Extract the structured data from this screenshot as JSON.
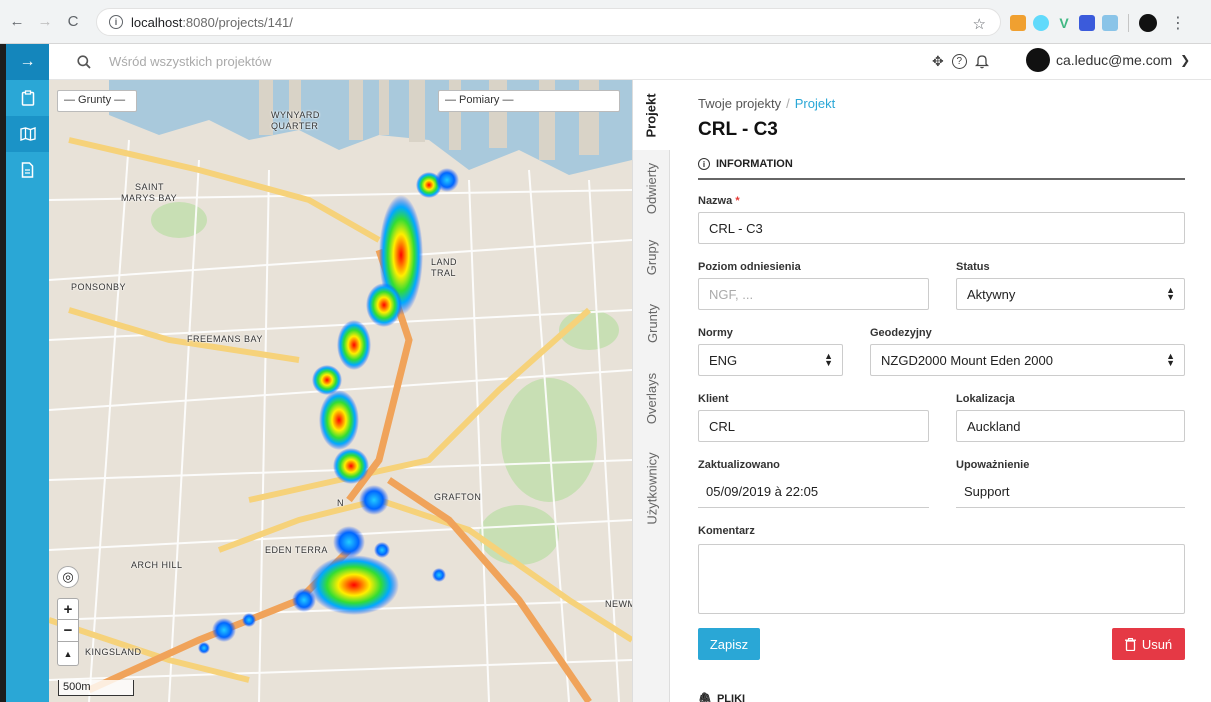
{
  "browser": {
    "url_host": "localhost",
    "url_path": ":8080/projects/141/"
  },
  "topbar": {
    "search_placeholder": "Wśród wszystkich projektów",
    "user_email": "ca.leduc@me.com"
  },
  "map": {
    "select_soils": "— Grunty —",
    "select_measurements": "— Pomiary —",
    "scale_label": "500m",
    "zoom_in": "+",
    "zoom_out": "−",
    "north_glyph": "▲",
    "locate_glyph": "◎",
    "labels": {
      "wynyard": "WYNYARD",
      "quarter": "QUARTER",
      "saint": "SAINT",
      "marys_bay": "MARYS BAY",
      "ponsonby": "PONSONBY",
      "freemans_bay": "FREEMANS BAY",
      "grafton": "GRAFTON",
      "eden_terra": "EDEN TERRA",
      "arch_hill": "ARCH HILL",
      "kingsland": "KINGSLAND",
      "newm": "NEWM",
      "land": "LAND",
      "tral": "TRAL",
      "n": "N"
    }
  },
  "vtabs": [
    "Projekt",
    "Odwierty",
    "Grupy",
    "Grunty",
    "Overlays",
    "Użytkownicy"
  ],
  "panel": {
    "breadcrumb_root": "Twoje projekty",
    "breadcrumb_sep": "/",
    "breadcrumb_current": "Projekt",
    "title": "CRL - C3",
    "section": "INFORMATION",
    "name_label": "Nazwa",
    "name_required": "*",
    "name_value": "CRL - C3",
    "ref_level_label": "Poziom odniesienia",
    "ref_level_placeholder": "NGF, ...",
    "status_label": "Status",
    "status_value": "Aktywny",
    "norms_label": "Normy",
    "norms_value": "ENG",
    "geodetic_label": "Geodezyjny",
    "geodetic_value": "NZGD2000 Mount Eden 2000",
    "client_label": "Klient",
    "client_value": "CRL",
    "location_label": "Lokalizacja",
    "location_value": "Auckland",
    "updated_label": "Zaktualizowano",
    "updated_value": "05/09/2019 à 22:05",
    "authorization_label": "Upoważnienie",
    "authorization_value": "Support",
    "comment_label": "Komentarz",
    "save_label": "Zapisz",
    "delete_label": "Usuń",
    "files_label": "PLIKI"
  },
  "colors": {
    "accent": "#2aa7d6",
    "danger": "#e53945",
    "sidebar_dark": "#1486bc"
  }
}
